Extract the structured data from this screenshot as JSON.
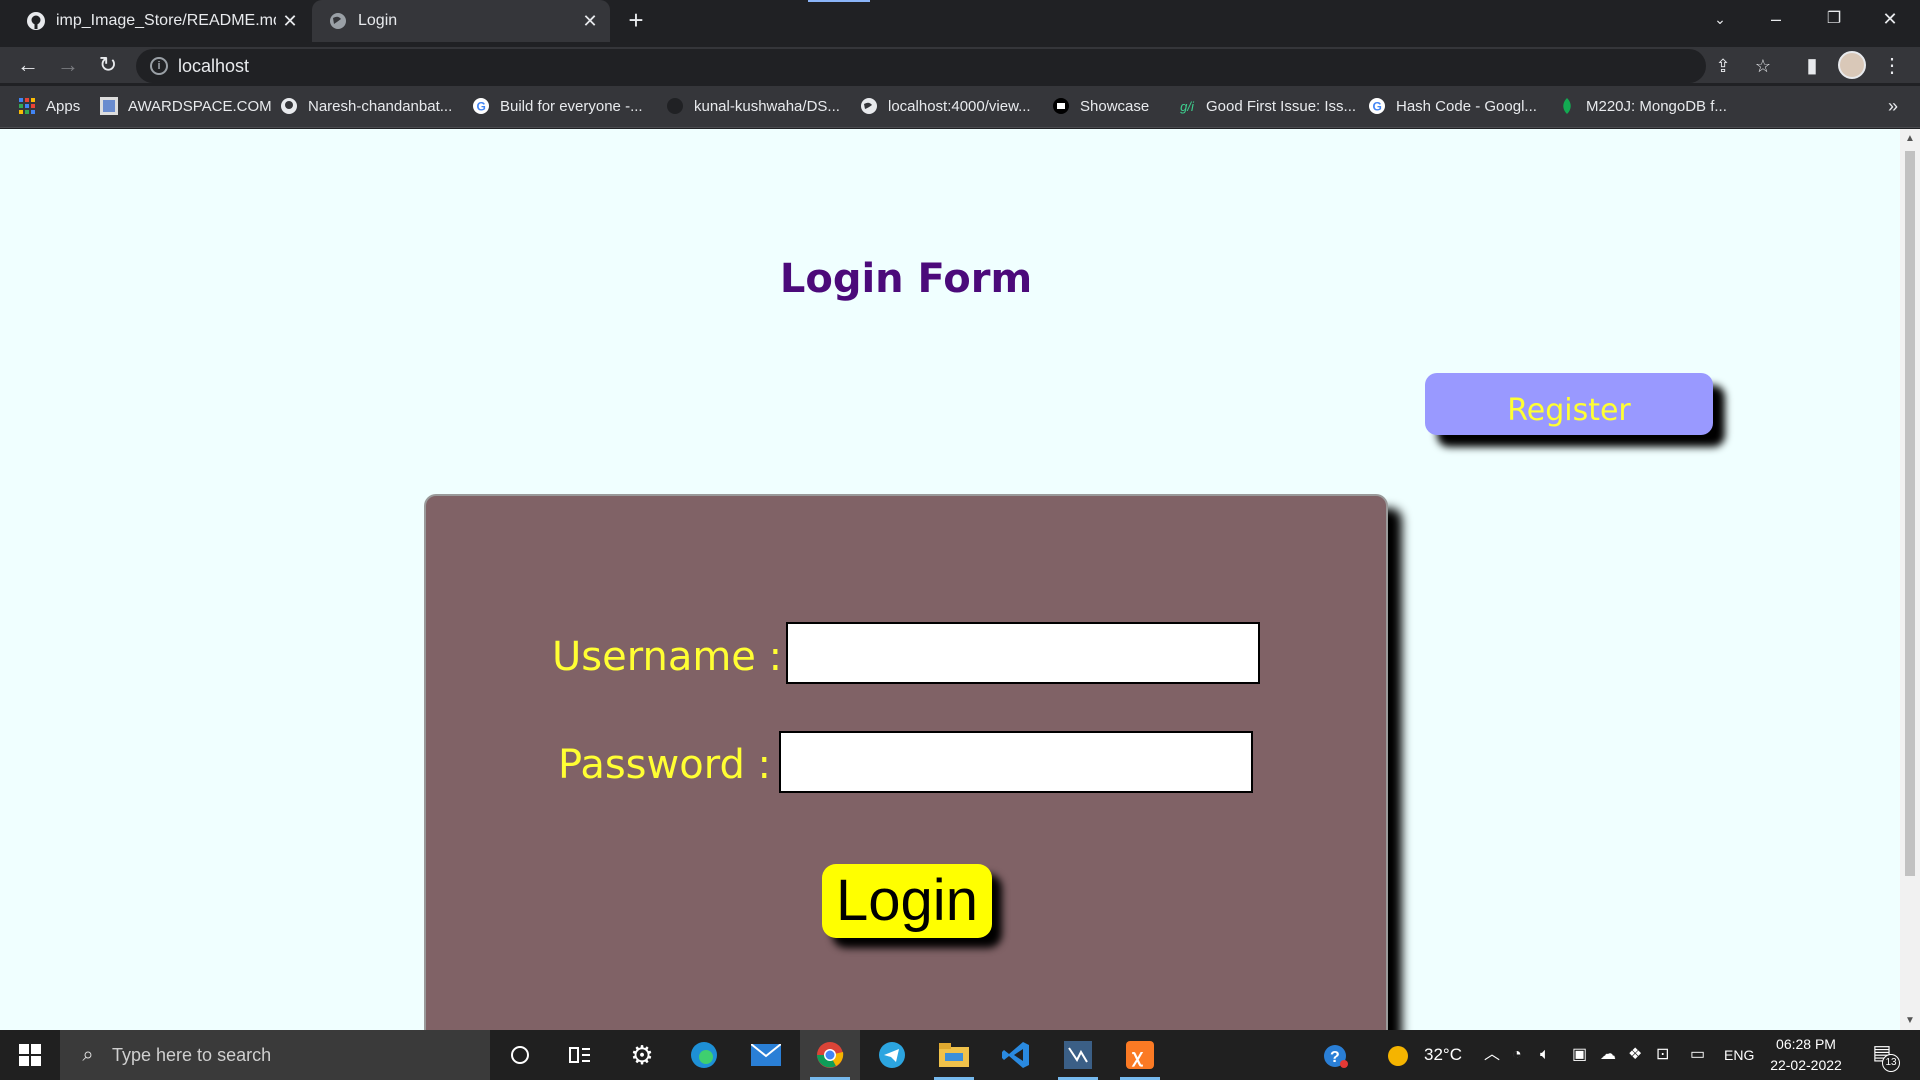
{
  "browser": {
    "tabs": [
      {
        "title": "imp_Image_Store/README.md at",
        "icon": "github-icon",
        "active": false
      },
      {
        "title": "Login",
        "icon": "globe-icon",
        "active": true
      }
    ],
    "new_tab_label": "+",
    "url": "localhost",
    "bookmarks": [
      {
        "label": "Apps",
        "icon": "apps-grid-icon"
      },
      {
        "label": "AWARDSPACE.COM",
        "icon": "awardspace-icon"
      },
      {
        "label": "Naresh-chandanbat...",
        "icon": "github-icon"
      },
      {
        "label": "Build for everyone -...",
        "icon": "google-icon"
      },
      {
        "label": "kunal-kushwaha/DS...",
        "icon": "github-icon"
      },
      {
        "label": "localhost:4000/view...",
        "icon": "globe-icon"
      },
      {
        "label": "Showcase",
        "icon": "showcase-icon"
      },
      {
        "label": "Good First Issue: Iss...",
        "icon": "gfi-icon"
      },
      {
        "label": "Hash Code - Googl...",
        "icon": "google-icon"
      },
      {
        "label": "M220J: MongoDB f...",
        "icon": "mongodb-leaf-icon"
      }
    ],
    "bookmarks_overflow": "»"
  },
  "page": {
    "title": "Login Form",
    "register_label": "Register",
    "form": {
      "username_label": "Username :",
      "password_label": "Password :",
      "username_value": "",
      "password_value": "",
      "login_label": "Login"
    },
    "colors": {
      "background": "#f0ffff",
      "title": "#4b0a7a",
      "register_bg": "#9999ff",
      "register_text": "#ffff33",
      "card_bg": "#806266",
      "label_text": "#ffff33",
      "login_bg": "#ffff00"
    }
  },
  "taskbar": {
    "search_placeholder": "Type here to search",
    "apps": [
      "cortana-icon",
      "task-view-icon",
      "settings-gear-icon",
      "edge-icon",
      "mail-icon",
      "chrome-icon",
      "telegram-icon",
      "file-explorer-icon",
      "vscode-icon",
      "mysql-workbench-icon",
      "xampp-icon"
    ],
    "weather": "32°C",
    "language": "ENG",
    "time": "06:28 PM",
    "date": "22-02-2022",
    "notification_count": "13"
  }
}
